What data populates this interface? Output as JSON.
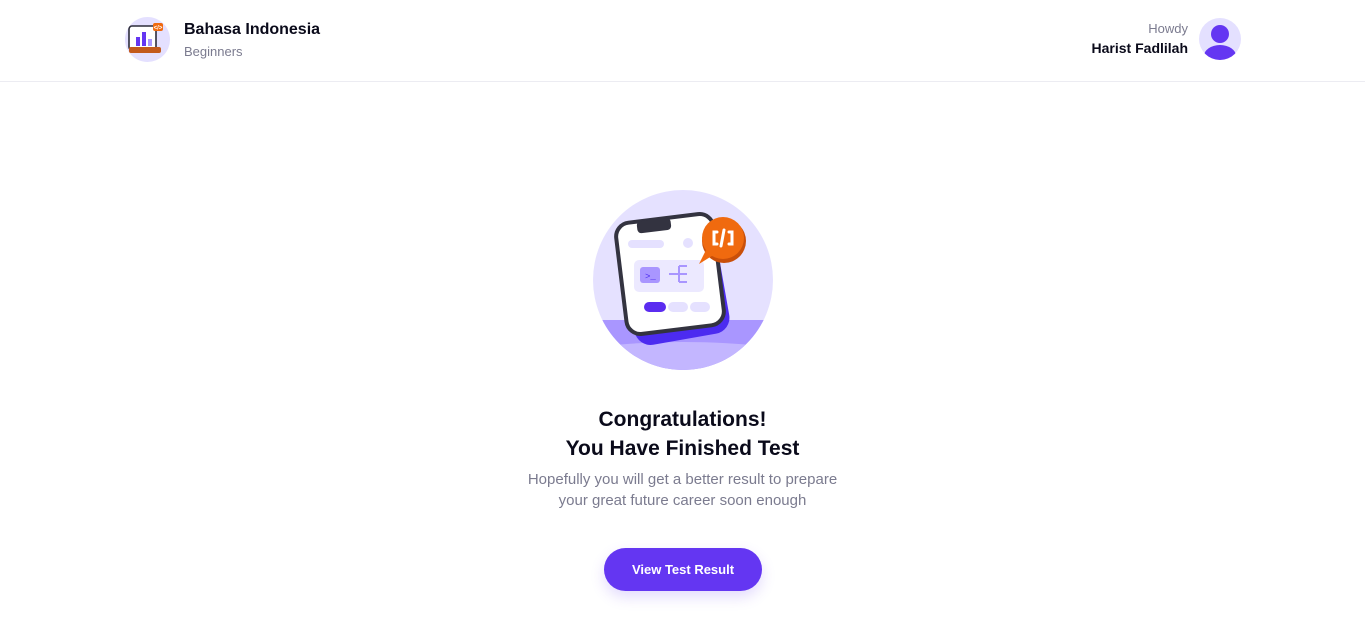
{
  "header": {
    "course_title": "Bahasa Indonesia",
    "course_level": "Beginners",
    "greeting": "Howdy",
    "user_name": "Harist Fadlilah"
  },
  "main": {
    "title_line1": "Congratulations!",
    "title_line2": "You Have Finished Test",
    "subtitle_line1": "Hopefully you will get a better result to prepare",
    "subtitle_line2": "your great future career soon enough",
    "cta_label": "View Test Result"
  },
  "colors": {
    "accent": "#6436f2",
    "accent_light": "#e4e0ff",
    "badge_orange": "#f06a0f"
  },
  "icons": {
    "course": "course-thumbnail-icon",
    "avatar": "user-avatar-icon",
    "illustration": "phone-code-illustration"
  }
}
